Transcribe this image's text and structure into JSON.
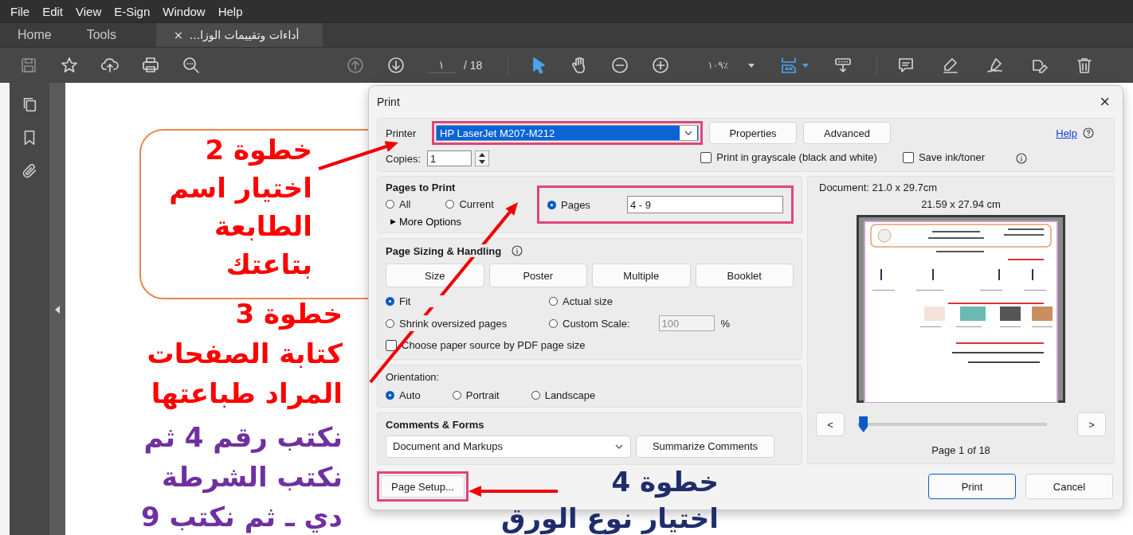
{
  "menu": [
    "File",
    "Edit",
    "View",
    "E-Sign",
    "Window",
    "Help"
  ],
  "tabs": [
    {
      "label": "Home",
      "selected": false
    },
    {
      "label": "Tools",
      "selected": false
    },
    {
      "label": "أداءات وتقييمات الوزا...",
      "selected": true,
      "close": "×"
    }
  ],
  "toolbar": {
    "page": "١",
    "page_total": "/ 18",
    "zoom": "١٠٩٪"
  },
  "dialog": {
    "title": "Print",
    "close": "×",
    "printer": {
      "label": "Printer",
      "value": "HP LaserJet M207-M212",
      "highlighted": true
    },
    "header_buttons": [
      "Properties",
      "Advanced"
    ],
    "help": "Help",
    "copies": {
      "label": "Copies:",
      "value": "1"
    },
    "options": [
      {
        "label": "Print in grayscale (black and white)",
        "checked": false
      },
      {
        "label": "Save ink/toner",
        "checked": false
      }
    ],
    "pages_to_print": {
      "title": "Pages to Print",
      "choices": [
        {
          "label": "All",
          "selected": false
        },
        {
          "label": "Current",
          "selected": false
        },
        {
          "label": "Pages",
          "selected": true
        }
      ],
      "pages_value": "4 - 9",
      "highlighted": true,
      "more_icon": "▶",
      "more": "More Options"
    },
    "page_sizing": {
      "title": "Page Sizing & Handling",
      "modes": [
        "Size",
        "Poster",
        "Multiple",
        "Booklet"
      ],
      "choices": [
        {
          "label": "Fit",
          "selected": true
        },
        {
          "label": "Actual size",
          "selected": false
        },
        {
          "label": "Shrink oversized pages",
          "selected": false
        },
        {
          "label": "Custom Scale:",
          "selected": false
        }
      ],
      "scale_value": "100",
      "scale_unit": "%",
      "paper_source": {
        "label": "Choose paper source by PDF page size",
        "checked": false
      }
    },
    "orientation": {
      "title": "Orientation:",
      "choices": [
        {
          "label": "Auto",
          "selected": true
        },
        {
          "label": "Portrait",
          "selected": false
        },
        {
          "label": "Landscape",
          "selected": false
        }
      ]
    },
    "comments": {
      "title": "Comments & Forms",
      "value": "Document and Markups",
      "button": "Summarize Comments"
    },
    "page_setup": {
      "label": "Page Setup...",
      "highlighted": true
    },
    "actions": [
      "Print",
      "Cancel"
    ],
    "preview": {
      "document": "Document: 21.0 x 29.7cm",
      "paper": "21.59 x 27.94 cm",
      "prev": "<",
      "next": ">",
      "level": 0.03,
      "page_label": "Page 1 of 18"
    }
  },
  "annotations": [
    {
      "lines": [
        "خطوة 2",
        "اختيار اسم",
        "الطابعة",
        "بتاعتك"
      ],
      "color": "#ff0000"
    },
    {
      "lines": [
        "خطوة 3",
        "كتابة الصفحات",
        "المراد طباعتها"
      ],
      "color": "#ff0000"
    },
    {
      "lines": [
        "خطوة 4",
        "اختيار نوع الورق"
      ],
      "color": "#1f2d6b"
    },
    {
      "lines": [
        "نكتب رقم 4 ثم",
        "نكتب الشرطة",
        "دي ـ ثم نكتب 9"
      ],
      "color": "#7030a0"
    }
  ]
}
